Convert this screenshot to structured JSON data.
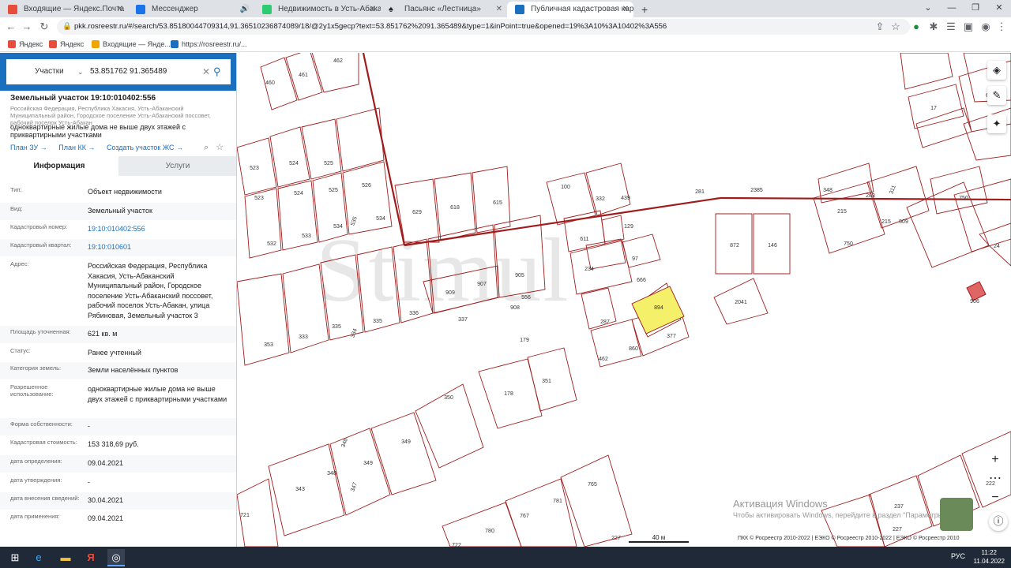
{
  "browser": {
    "tabs": [
      {
        "label": "Входящие — Яндекс.Почта",
        "icon": "yandex-mail-icon",
        "color": "#e74c3c"
      },
      {
        "label": "Мессенджер",
        "icon": "messenger-icon",
        "color": "#1a73e8"
      },
      {
        "label": "Недвижимость в Усть-Абакане",
        "icon": "cian-icon",
        "color": "#2ecc71"
      },
      {
        "label": "Пасьянс «Лестница»",
        "icon": "spade-icon",
        "color": "#222222"
      },
      {
        "label": "Публичная кадастровая карта",
        "icon": "rosreestr-icon",
        "color": "#1a6fbe"
      }
    ],
    "url": "pkk.rosreestr.ru/#/search/53.85180044709314,91.36510236874089/18/@2y1x5gecp?text=53.851762%2091.365489&type=1&inPoint=true&opened=19%3A10%3A10402%3A556",
    "bookmarks": [
      {
        "label": "Яндекс",
        "color": "#e74c3c"
      },
      {
        "label": "Яндекс",
        "color": "#e74c3c"
      },
      {
        "label": "Входящие — Яндe...",
        "color": "#f0a500"
      },
      {
        "label": "https://rosreestr.ru/...",
        "color": "#1a6fbe"
      }
    ]
  },
  "search": {
    "type": "Участки",
    "query": "53.851762 91.365489"
  },
  "parcel": {
    "title": "Земельный участок 19:10:010402:556",
    "description": "Российская Федерация, Республика Хакасия, Усть-Абаканский Муниципальный район, Городское поселение Усть-Абаканский поссовет, рабочий поселок Усть-Абакан",
    "use": "одноквартирные жилые дома не выше двух этажей с приквартирными участками",
    "links": [
      "План ЗУ →",
      "План КК →",
      "Создать участок ЖС →"
    ]
  },
  "tabs": {
    "info": "Информация",
    "services": "Услуги"
  },
  "rows": [
    {
      "k": "Тип:",
      "v": "Объект недвижимости"
    },
    {
      "k": "Вид:",
      "v": "Земельный участок"
    },
    {
      "k": "Кадастровый номер:",
      "v": "19:10:010402:556"
    },
    {
      "k": "Кадастровый квартал:",
      "v": "19:10:010601"
    },
    {
      "k": "Адрес:",
      "v": "Российская Федерация, Республика Хакасия, Усть-Абаканский Муниципальный район, Городское поселение Усть-Абаканский поссовет, рабочий поселок Усть-Абакан, улица Рябиновая, Земельный участок 3"
    },
    {
      "k": "Площадь уточненная:",
      "v": "621 кв. м"
    },
    {
      "k": "Статус:",
      "v": "Ранее учтенный"
    },
    {
      "k": "Категория земель:",
      "v": "Земли населённых пунктов"
    },
    {
      "k": "Разрешенное использование:",
      "v": "одноквартирные жилые дома не выше двух этажей с приквартирными участками"
    },
    {
      "k": "Форма собственности:",
      "v": "-"
    },
    {
      "k": "Кадастровая стоимость:",
      "v": "153 318,69 руб."
    },
    {
      "k": "дата определения:",
      "v": "09.04.2021"
    },
    {
      "k": "дата утверждения:",
      "v": "-"
    },
    {
      "k": "дата внесения сведений:",
      "v": "30.04.2021"
    },
    {
      "k": "дата применения:",
      "v": "09.04.2021"
    }
  ],
  "map": {
    "watermark_brand": "Stimul",
    "scale": "40 м",
    "windows_activation": "Активация Windows",
    "windows_activation_sub": "Чтобы активировать Windows, перейдите в раздел \"Параметры\".",
    "attribution": "ПКК © Росреестр 2010-2022 | ЕЭКО © Росреестр 2010-2022 | ЕЭКО © Росреестр 2010",
    "selected_color": "#f4f06a",
    "line_color": "#a01c1c",
    "parcels": [
      "462",
      "461",
      "460",
      "886",
      "675",
      "17",
      "523",
      "524",
      "525",
      "523",
      "524",
      "525",
      "526",
      "532",
      "533",
      "534",
      "535",
      "534",
      "629",
      "618",
      "615",
      "100",
      "332",
      "439",
      "281",
      "2385",
      "348",
      "283",
      "311",
      "215",
      "215",
      "509",
      "750",
      "750",
      "24",
      "604",
      "611",
      "129",
      "97",
      "234",
      "666",
      "556",
      "894",
      "287",
      "377",
      "860",
      "462",
      "872",
      "146",
      "2041",
      "906",
      "907",
      "905",
      "909",
      "908",
      "337",
      "336",
      "335",
      "335",
      "334",
      "333",
      "353",
      "179",
      "178",
      "351",
      "350",
      "349",
      "349",
      "348",
      "348",
      "347",
      "343",
      "721",
      "765",
      "781",
      "767",
      "780",
      "722",
      "227",
      "237",
      "214",
      "222",
      "227"
    ]
  },
  "taskbar": {
    "lang": "РУС",
    "time": "11:22",
    "date": "11.04.2022"
  }
}
